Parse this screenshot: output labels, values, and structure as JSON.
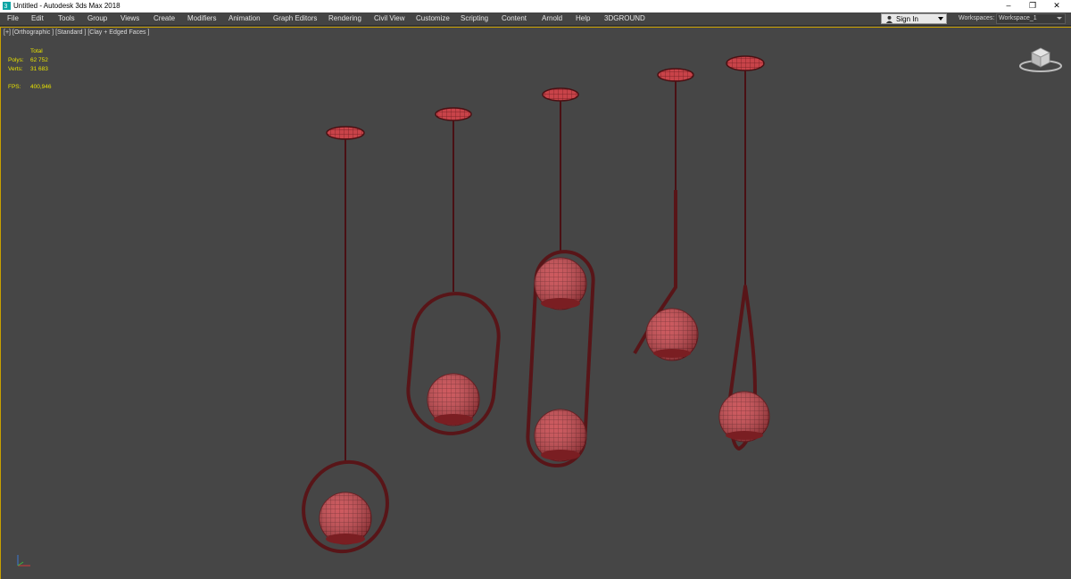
{
  "window": {
    "title": "Untitled - Autodesk 3ds Max 2018",
    "app_icon": "3dsmax-icon",
    "controls": {
      "minimize": "–",
      "restore": "❐",
      "close": "✕"
    }
  },
  "menubar": {
    "items": [
      {
        "label": "File"
      },
      {
        "label": "Edit"
      },
      {
        "label": "Tools"
      },
      {
        "label": "Group"
      },
      {
        "label": "Views"
      },
      {
        "label": "Create"
      },
      {
        "label": "Modifiers"
      },
      {
        "label": "Animation"
      },
      {
        "label": "Graph Editors"
      },
      {
        "label": "Rendering"
      },
      {
        "label": "Civil View"
      },
      {
        "label": "Customize"
      },
      {
        "label": "Scripting"
      },
      {
        "label": "Content"
      },
      {
        "label": "Arnold"
      },
      {
        "label": "Help"
      },
      {
        "label": "3DGROUND"
      }
    ],
    "sign_in": "Sign In",
    "workspaces_label": "Workspaces:",
    "workspace_value": "Workspace_1"
  },
  "viewport": {
    "label": "[+] [Orthographic ] [Standard ] [Clay + Edged Faces ]",
    "stats": {
      "total_label": "Total",
      "polys_label": "Polys:",
      "polys_value": "62 752",
      "verts_label": "Verts:",
      "verts_value": "31 683",
      "fps_label": "FPS:",
      "fps_value": "400,946"
    }
  },
  "colors": {
    "viewport_bg": "#464646",
    "active_border": "#c8a000",
    "stats_text": "#e7e100",
    "lamp_body": "#5a1518",
    "globe_fill": "#c8454a"
  }
}
